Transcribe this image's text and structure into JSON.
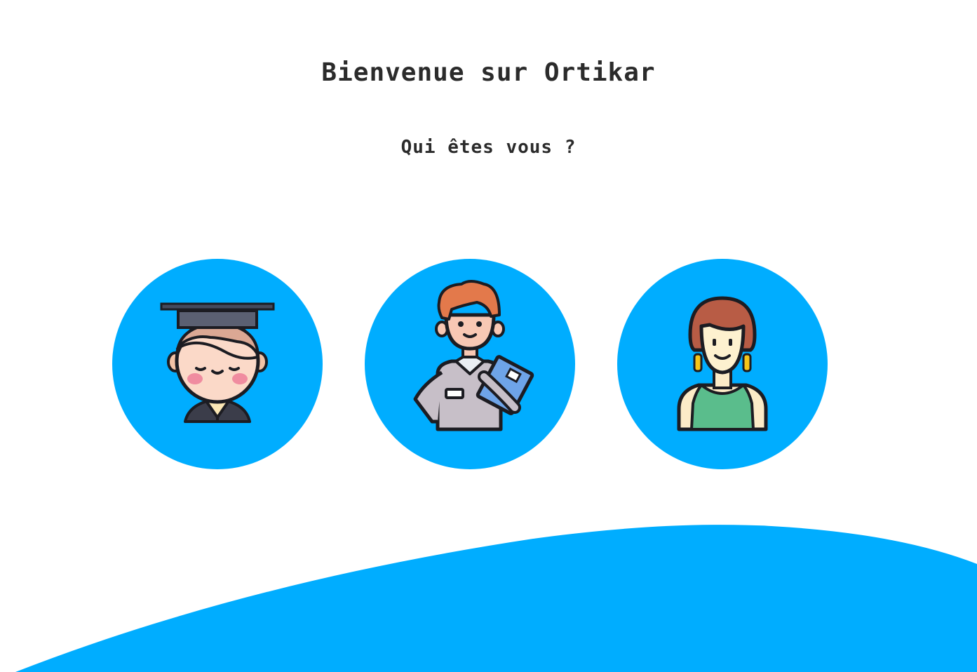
{
  "header": {
    "title": "Bienvenue sur Ortikar",
    "subtitle": "Qui êtes vous ?"
  },
  "choices": [
    {
      "icon": "graduate-student-icon"
    },
    {
      "icon": "delivery-worker-icon"
    },
    {
      "icon": "woman-avatar-icon"
    }
  ],
  "colors": {
    "accent": "#00adff",
    "text": "#2b2b2b",
    "background": "#ffffff"
  }
}
